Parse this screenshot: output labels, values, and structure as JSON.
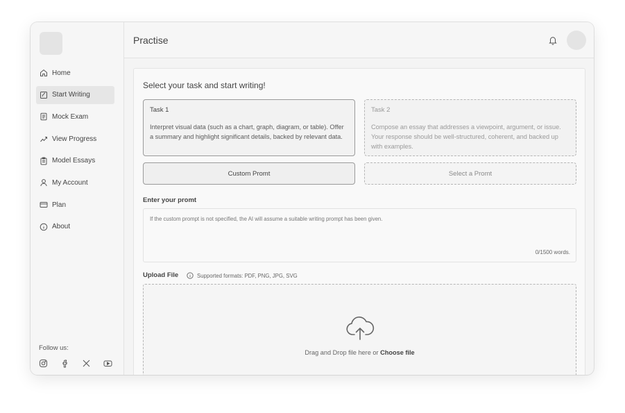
{
  "app": {
    "page_title": "Practise"
  },
  "sidebar": {
    "items": [
      {
        "label": "Home",
        "icon": "home-icon",
        "active": false
      },
      {
        "label": "Start Writing",
        "icon": "edit-icon",
        "active": true
      },
      {
        "label": "Mock Exam",
        "icon": "document-icon",
        "active": false
      },
      {
        "label": "View Progress",
        "icon": "trend-icon",
        "active": false
      },
      {
        "label": "Model Essays",
        "icon": "clipboard-icon",
        "active": false
      },
      {
        "label": "My Account",
        "icon": "user-icon",
        "active": false
      },
      {
        "label": "Plan",
        "icon": "card-icon",
        "active": false
      },
      {
        "label": "About",
        "icon": "info-icon",
        "active": false
      }
    ],
    "follow_label": "Follow us:",
    "socials": [
      "instagram-icon",
      "facebook-icon",
      "x-icon",
      "youtube-icon"
    ]
  },
  "main": {
    "heading": "Select your task and start writing!",
    "tasks": [
      {
        "name": "Task 1",
        "description": "Interpret visual data (such as a chart, graph, diagram, or table). Offer a summary and highlight significant details, backed by relevant data."
      },
      {
        "name": "Task 2",
        "description": "Compose an essay that addresses a viewpoint, argument, or issue. Your response should be well-structured, coherent, and backed up with examples."
      }
    ],
    "custom_prompt_label": "Custom Promt",
    "select_prompt_label": "Select a Promt",
    "prompt_label": "Enter your promt",
    "prompt_placeholder": "If the custom prompt is not specified, the AI will assume a suitable writing prompt has been given.",
    "word_counter": "0/1500 words.",
    "upload_label": "Upload File",
    "formats_text": "Supported formats: PDF, PNG, JPG, SVG",
    "drop_text": "Drag and Drop file here or",
    "choose_file": "Choose file"
  }
}
